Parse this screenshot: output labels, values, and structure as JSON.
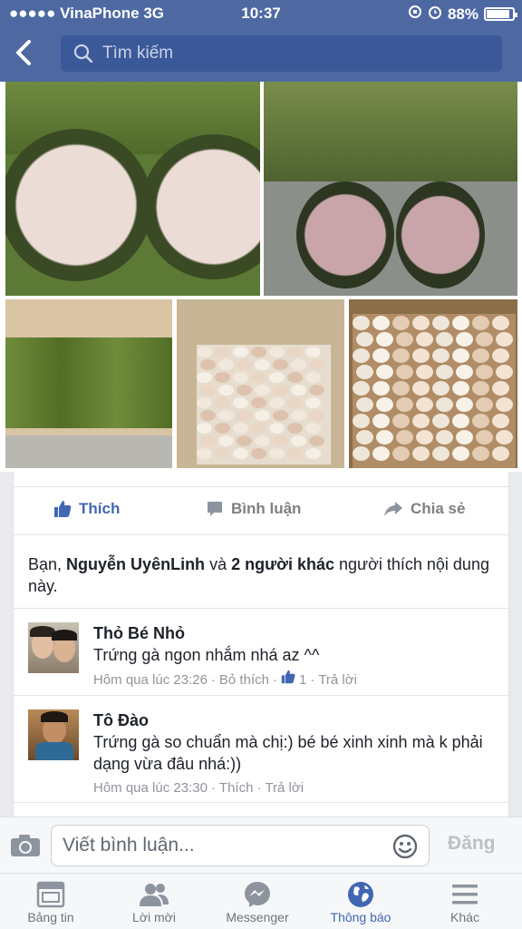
{
  "status": {
    "carrier": "●●●●● VinaPhone  3G",
    "time": "10:37",
    "battery": "88%"
  },
  "header": {
    "search_placeholder": "Tìm kiếm",
    "back_icon": "chevron-left-icon"
  },
  "actions": {
    "like": "Thích",
    "comment": "Bình luận",
    "share": "Chia sẻ"
  },
  "likes": {
    "prefix": "Bạn,",
    "name": "Nguyễn UyênLinh",
    "and": "và",
    "others": "2 người khác",
    "suffix": "người thích nội dung này."
  },
  "comments": [
    {
      "author": "Thỏ Bé Nhỏ",
      "text": "Trứng gà ngon nhắm nhá az ^^",
      "time": "Hôm qua lúc 23:26",
      "like_action": "Bỏ thích",
      "like_count": "1",
      "reply": "Trả lời"
    },
    {
      "author": "Tô Đào",
      "text": "Trứng gà so chuẩn mà chị:) bé bé xinh xinh mà k phải dạng vừa đâu nhá:))",
      "time": "Hôm qua lúc 23:30",
      "like_action": "Thích",
      "reply": "Trả lời"
    }
  ],
  "composer": {
    "placeholder": "Viết bình luận...",
    "post": "Đăng"
  },
  "tabs": [
    {
      "label": "Bảng tin",
      "icon": "news-feed-icon"
    },
    {
      "label": "Lời mời",
      "icon": "friends-icon"
    },
    {
      "label": "Messenger",
      "icon": "messenger-icon"
    },
    {
      "label": "Thông báo",
      "icon": "globe-icon",
      "active": true
    },
    {
      "label": "Khác",
      "icon": "menu-icon"
    }
  ],
  "colors": {
    "brand": "#4e69a2",
    "link": "#4267b2"
  }
}
